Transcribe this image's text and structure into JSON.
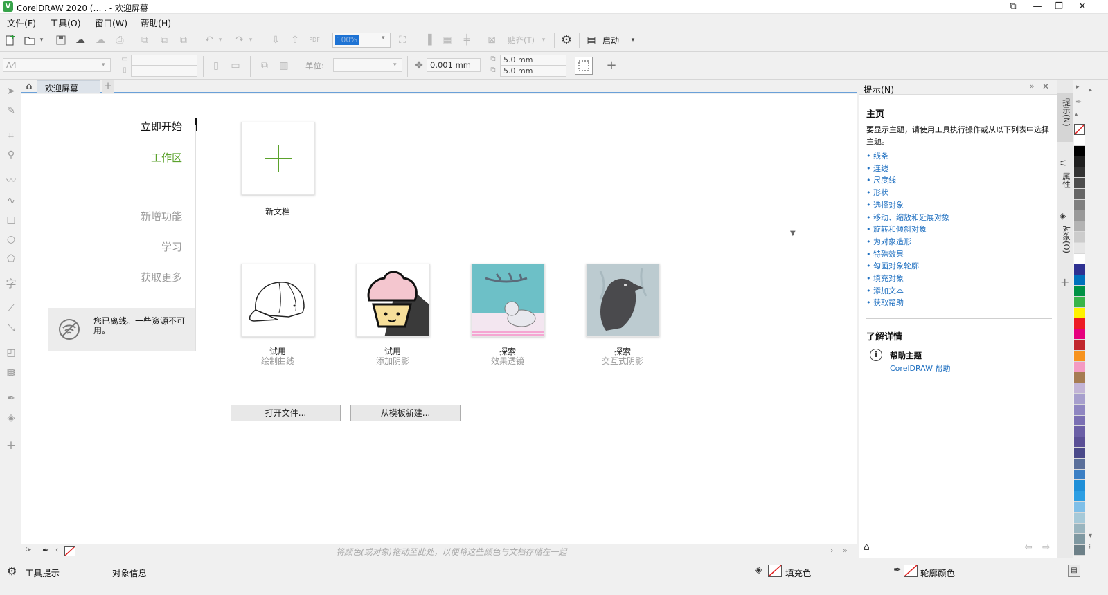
{
  "window": {
    "title": "CorelDRAW 2020 (…                      . - 欢迎屏幕",
    "logo": "V",
    "controls": [
      "⧉",
      "—",
      "❐",
      "✕"
    ]
  },
  "menu": [
    "文件(F)",
    "工具(O)",
    "窗口(W)",
    "帮助(H)"
  ],
  "toolbar1": {
    "zoom_value": "100%",
    "launch_label": "启动",
    "paste_label": "贴齐(T)"
  },
  "toolbar2": {
    "page_size": "A4",
    "units_label": "单位:",
    "nudge_value": "0.001 mm",
    "dup_x": "5.0 mm",
    "dup_y": "5.0 mm"
  },
  "doc_tab": {
    "label": "欢迎屏幕",
    "add": "+"
  },
  "welcome": {
    "nav": {
      "get_started": "立即开始",
      "workspace": "工作区",
      "whats_new": "新增功能",
      "learn": "学习",
      "get_more": "获取更多"
    },
    "offline_notice": "您已离线。一些资源不可用。",
    "new_doc_label": "新文档",
    "cards": [
      {
        "title": "试用",
        "subtitle": "绘制曲线",
        "icon": "cap-icon"
      },
      {
        "title": "试用",
        "subtitle": "添加阴影",
        "icon": "cupcake-icon"
      },
      {
        "title": "探索",
        "subtitle": "效果透镜",
        "icon": "cat-icon"
      },
      {
        "title": "探索",
        "subtitle": "交互式阴影",
        "icon": "raven-icon"
      }
    ],
    "open_file_button": "打开文件...",
    "from_template_button": "从模板新建..."
  },
  "color_strip_hint": "将颜色(或对象)拖动至此处，以便将这些颜色与文档存储在一起",
  "status": {
    "tool_hint": "工具提示",
    "object_info": "对象信息",
    "fill_label": "填充色",
    "outline_label": "轮廓颜色"
  },
  "hints_panel": {
    "title": "提示(N)",
    "home_heading": "主页",
    "description": "要显示主题，请使用工具执行操作或从以下列表中选择主题。",
    "links": [
      "线条",
      "连线",
      "尺度线",
      "形状",
      "选择对象",
      "移动、缩放和延展对象",
      "旋转和倾斜对象",
      "为对象造形",
      "特殊效果",
      "勾画对象轮廓",
      "填充对象",
      "添加文本",
      "获取帮助"
    ],
    "learn_more_heading": "了解详情",
    "help_topics_label": "帮助主题",
    "help_link": "CorelDRAW 帮助"
  },
  "side_tabs": [
    "提示(N)",
    "属性",
    "对象(O)"
  ],
  "palette_colors": [
    "#ffffff",
    "#000000",
    "#1f1f1f",
    "#333333",
    "#4d4d4d",
    "#666666",
    "#808080",
    "#999999",
    "#b3b3b3",
    "#cccccc",
    "#e6e6e6",
    "#ffffff",
    "#2e3192",
    "#0071bc",
    "#009245",
    "#39b54a",
    "#fff200",
    "#ed1c24",
    "#e6007e",
    "#c1272d",
    "#f7931e",
    "#f49ac2",
    "#a67c52",
    "#c2b4d6",
    "#a79fcd",
    "#8f86c1",
    "#7a6fb3",
    "#6b5fa6",
    "#5b5096",
    "#4b4a8a",
    "#5a6f9a",
    "#3b7fc4",
    "#1f8fd8",
    "#2c9ee3",
    "#7fbfe8",
    "#a6c9d8",
    "#9ab5bf",
    "#7f98a1",
    "#6d8088"
  ],
  "accent_green": "#5ba22c",
  "accent_link": "#1e6fc0"
}
